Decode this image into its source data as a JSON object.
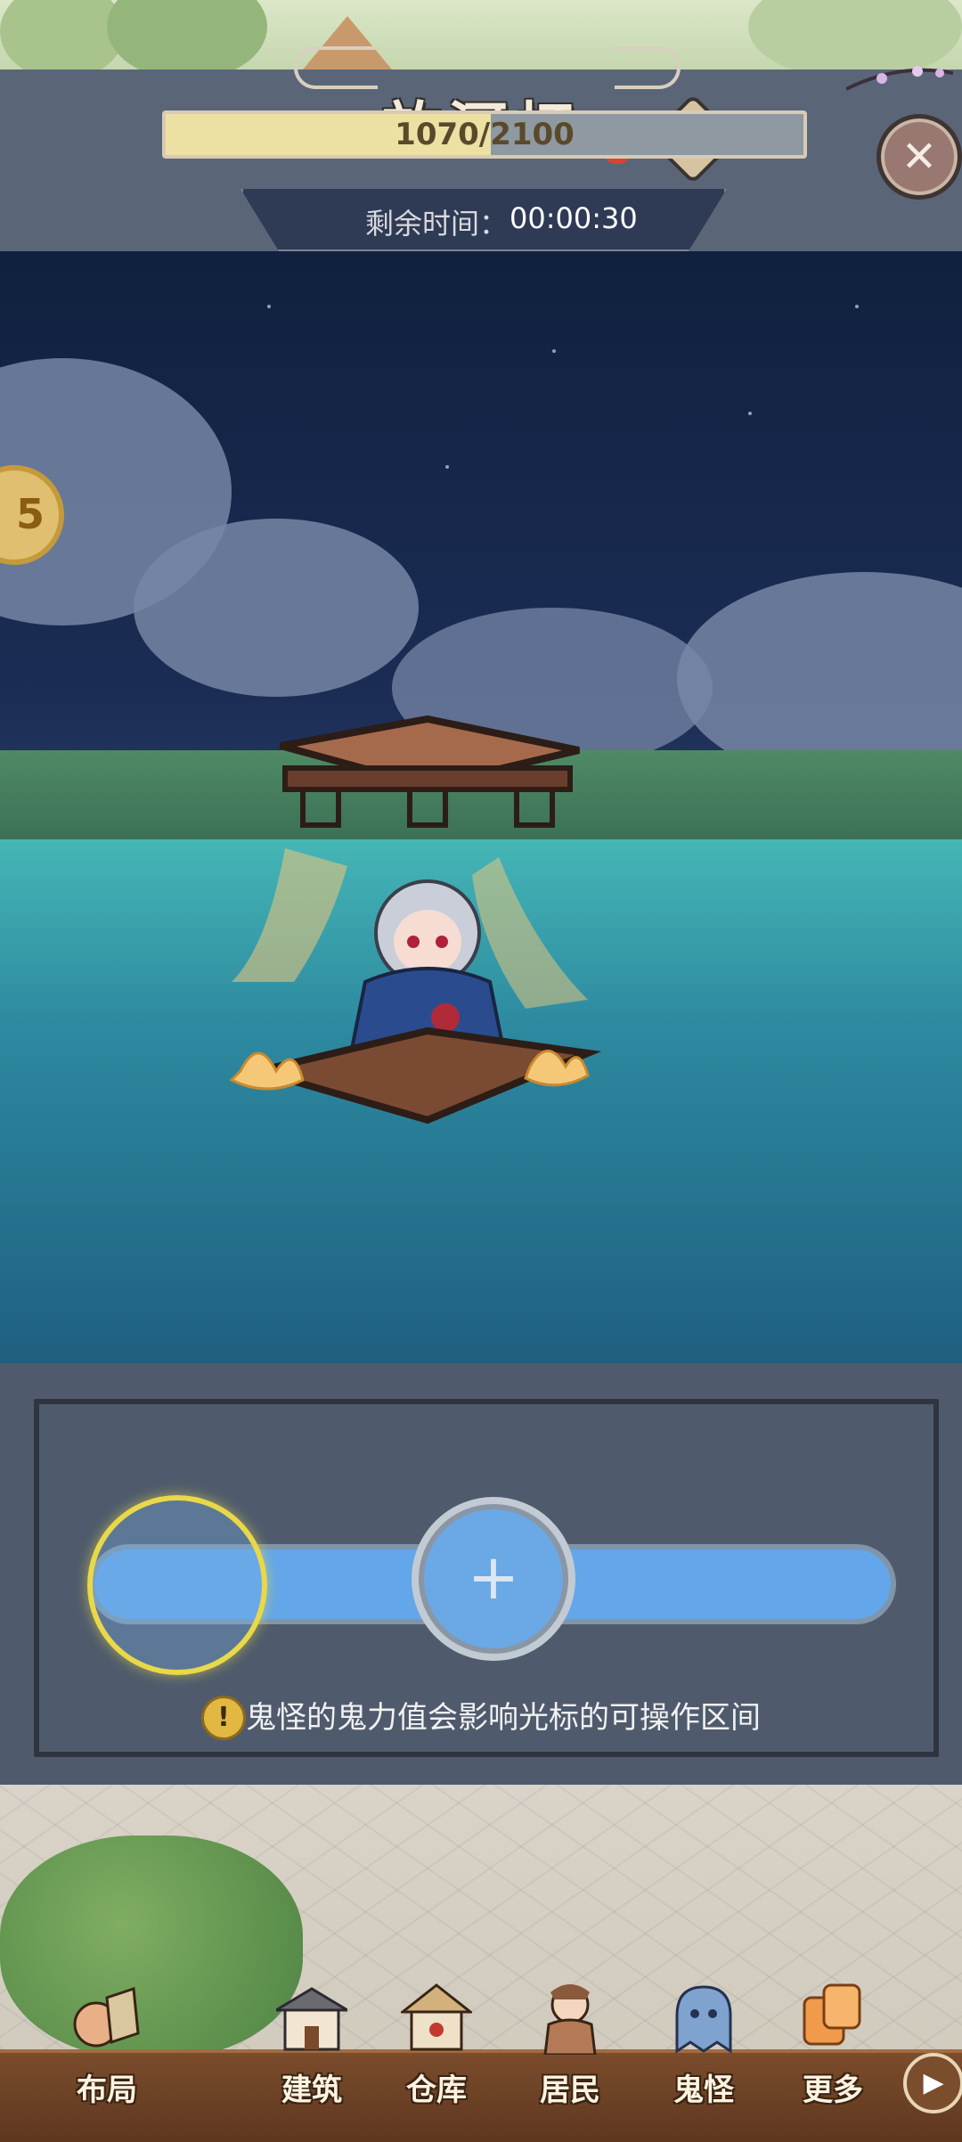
{
  "minigame": {
    "title": "放河灯",
    "progress": {
      "text": "1070/2100",
      "value": 1070,
      "max": 2100
    },
    "timer": {
      "label": "剩余时间：",
      "value": "00:00:30"
    },
    "slider": {
      "cursor_symbol": "+"
    },
    "hint": "鬼怪的鬼力值会影响光标的可操作区间",
    "help_symbol": "?",
    "close_symbol": "✕",
    "warning_symbol": "!"
  },
  "nav": {
    "items": [
      {
        "label": "布局",
        "icon": "layout-icon"
      },
      {
        "label": "建筑",
        "icon": "building-icon"
      },
      {
        "label": "仓库",
        "icon": "warehouse-icon"
      },
      {
        "label": "居民",
        "icon": "resident-icon"
      },
      {
        "label": "鬼怪",
        "icon": "ghost-icon"
      },
      {
        "label": "更多",
        "icon": "more-icon"
      }
    ],
    "arrow_symbol": "▶"
  },
  "colors": {
    "panel": "#4e5a6c",
    "progress_fill": "#ede0a3",
    "track": "#63a6e9",
    "zone_border": "#e8d84a",
    "nav_bar": "#6b4026"
  }
}
